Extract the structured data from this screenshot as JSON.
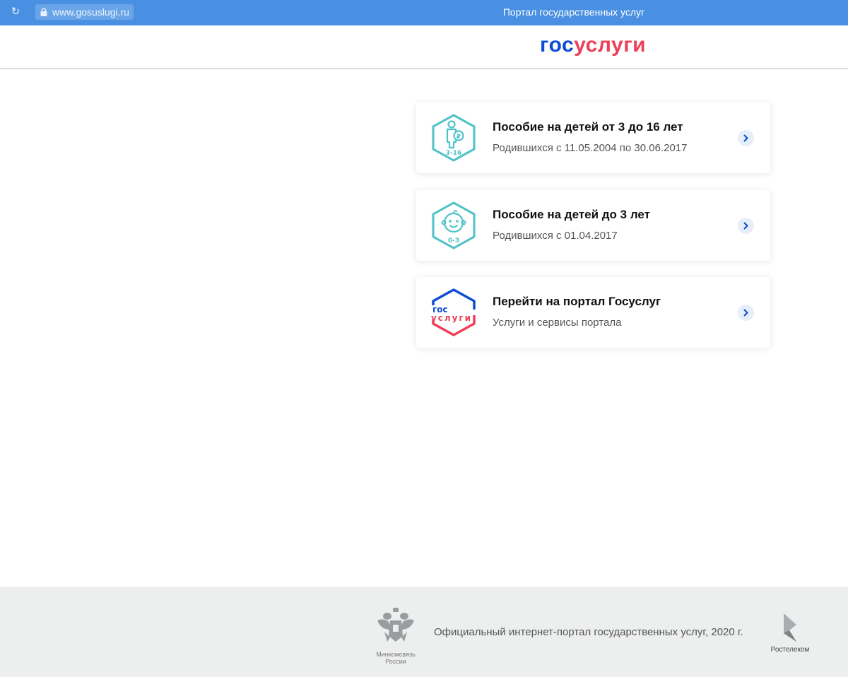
{
  "browser": {
    "url": "www.gosuslugi.ru",
    "title": "Портал государственных услуг"
  },
  "header": {
    "logo_part1": "гос",
    "logo_part2": "услуги"
  },
  "cards": [
    {
      "title": "Пособие на детей от 3 до 16 лет",
      "subtitle": "Родившихся с 11.05.2004 по 30.06.2017",
      "icon": "child-ruble-icon",
      "icon_label": "3-16"
    },
    {
      "title": "Пособие на детей до 3 лет",
      "subtitle": "Родившихся с 01.04.2017",
      "icon": "baby-face-icon",
      "icon_label": "0-3"
    },
    {
      "title": "Перейти на портал Госуслуг",
      "subtitle": "Услуги и сервисы портала",
      "icon": "gosuslugi-logo-icon",
      "icon_label_top": "гос",
      "icon_label_bottom": "услуги"
    }
  ],
  "footer": {
    "text": "Официальный интернет-портал государственных услуг, 2020 г.",
    "ministry_line1": "Минкомсвязь",
    "ministry_line2": "России",
    "operator": "Ростелеком"
  },
  "colors": {
    "browser_bar": "#4a90e2",
    "brand_blue": "#0d4cd3",
    "brand_red": "#ee3f58",
    "icon_teal": "#4fc3c8"
  }
}
